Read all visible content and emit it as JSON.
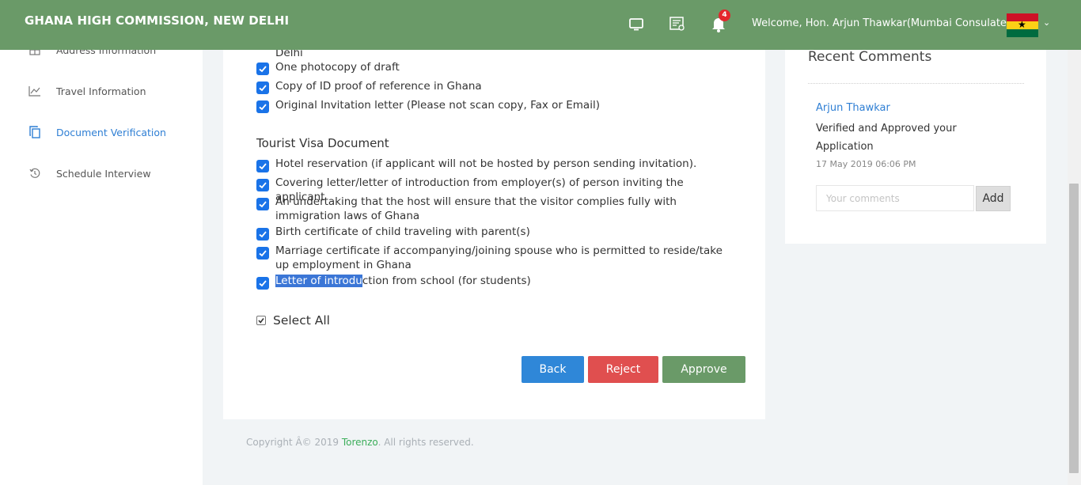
{
  "header": {
    "brand": "GHANA HIGH COMMISSION, NEW DELHI",
    "notification_count": "4",
    "welcome": "Welcome, Hon. Arjun Thawkar(Mumbai Consulates)",
    "icons": [
      "monitor-icon",
      "certificate-icon",
      "bell-icon"
    ],
    "accent_color": "#6a9a68"
  },
  "sidebar": {
    "items": [
      {
        "label": "Address Information",
        "icon": "grid-icon"
      },
      {
        "label": "Travel Information",
        "icon": "chart-icon"
      },
      {
        "label": "Document Verification",
        "icon": "copy-icon",
        "active": true
      },
      {
        "label": "Schedule Interview",
        "icon": "history-icon"
      }
    ]
  },
  "documents": {
    "partial_line": "Delhi",
    "group1": [
      "One photocopy of draft",
      "Copy of ID proof of reference in Ghana",
      "Original Invitation letter (Please not scan copy, Fax or Email)"
    ],
    "tourist_title": "Tourist Visa Document",
    "tourist": [
      "Hotel reservation (if applicant will not be hosted by person sending invitation).",
      "Covering letter/letter of introduction from employer(s) of person inviting the applicant",
      "An undertaking that the host will ensure that the visitor complies fully with immigration laws of Ghana",
      "Birth certificate of child traveling with parent(s)",
      "Marriage certificate if accompanying/joining spouse who is permitted to reside/take up employment in Ghana"
    ],
    "last_item_highlight": "Letter of introdu",
    "last_item_rest": "ction from school (for students)",
    "select_all": "Select All"
  },
  "actions": {
    "back": "Back",
    "reject": "Reject",
    "approve": "Approve"
  },
  "footer": {
    "prefix": "Copyright Â© 2019 ",
    "brand": "Torenzo",
    "suffix": ". All rights reserved."
  },
  "comments": {
    "title": "Recent Comments",
    "author": "Arjun Thawkar",
    "text": "Verified and Approved your Application",
    "date": "17 May 2019 06:06 PM",
    "placeholder": "Your comments",
    "add_label": "Add"
  }
}
